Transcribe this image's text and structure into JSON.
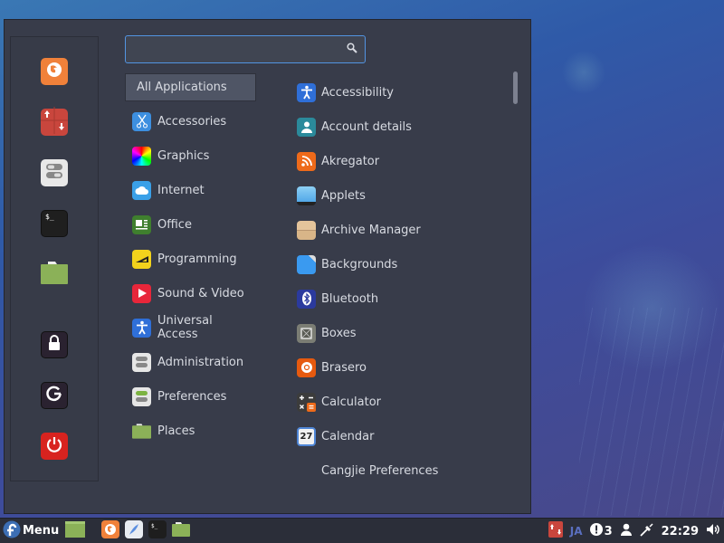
{
  "desktop": {
    "wallpaper": "jellyfish-blue"
  },
  "menu": {
    "search": {
      "value": "",
      "placeholder": ""
    },
    "favorites": [
      {
        "name": "firefox",
        "icon": "firefox-icon"
      },
      {
        "name": "software-update",
        "icon": "update-icon"
      },
      {
        "name": "settings",
        "icon": "settings-icon"
      },
      {
        "name": "terminal",
        "icon": "terminal-icon"
      },
      {
        "name": "files",
        "icon": "folder-icon"
      }
    ],
    "session": [
      {
        "name": "lock-screen",
        "icon": "lock-icon"
      },
      {
        "name": "logout",
        "icon": "logout-icon"
      },
      {
        "name": "shutdown",
        "icon": "power-icon"
      }
    ],
    "categories": [
      {
        "label": "All Applications",
        "active": true
      },
      {
        "label": "Accessories",
        "icon": "scissors-icon"
      },
      {
        "label": "Graphics",
        "icon": "graphics-icon"
      },
      {
        "label": "Internet",
        "icon": "cloud-icon"
      },
      {
        "label": "Office",
        "icon": "office-icon"
      },
      {
        "label": "Programming",
        "icon": "programming-icon"
      },
      {
        "label": "Sound & Video",
        "icon": "play-icon"
      },
      {
        "label": "Universal Access",
        "icon": "accessibility-icon"
      },
      {
        "label": "Administration",
        "icon": "toggles-icon"
      },
      {
        "label": "Preferences",
        "icon": "preferences-icon"
      },
      {
        "label": "Places",
        "icon": "folder-icon"
      }
    ],
    "applications": [
      {
        "label": "Accessibility",
        "icon": "accessibility-icon"
      },
      {
        "label": "Account details",
        "icon": "user-icon"
      },
      {
        "label": "Akregator",
        "icon": "rss-icon"
      },
      {
        "label": "Applets",
        "icon": "applets-icon"
      },
      {
        "label": "Archive Manager",
        "icon": "archive-icon"
      },
      {
        "label": "Backgrounds",
        "icon": "backgrounds-icon"
      },
      {
        "label": "Bluetooth",
        "icon": "bluetooth-icon"
      },
      {
        "label": "Boxes",
        "icon": "boxes-icon"
      },
      {
        "label": "Brasero",
        "icon": "disc-icon"
      },
      {
        "label": "Calculator",
        "icon": "calculator-icon"
      },
      {
        "label": "Calendar",
        "icon": "calendar-icon",
        "day": "27"
      },
      {
        "label": "Cangjie Preferences",
        "icon": ""
      }
    ]
  },
  "panel": {
    "menu_label": "Menu",
    "tray": {
      "keyboard_layout": "JA",
      "notification_count": "3",
      "clock": "22:29"
    }
  }
}
